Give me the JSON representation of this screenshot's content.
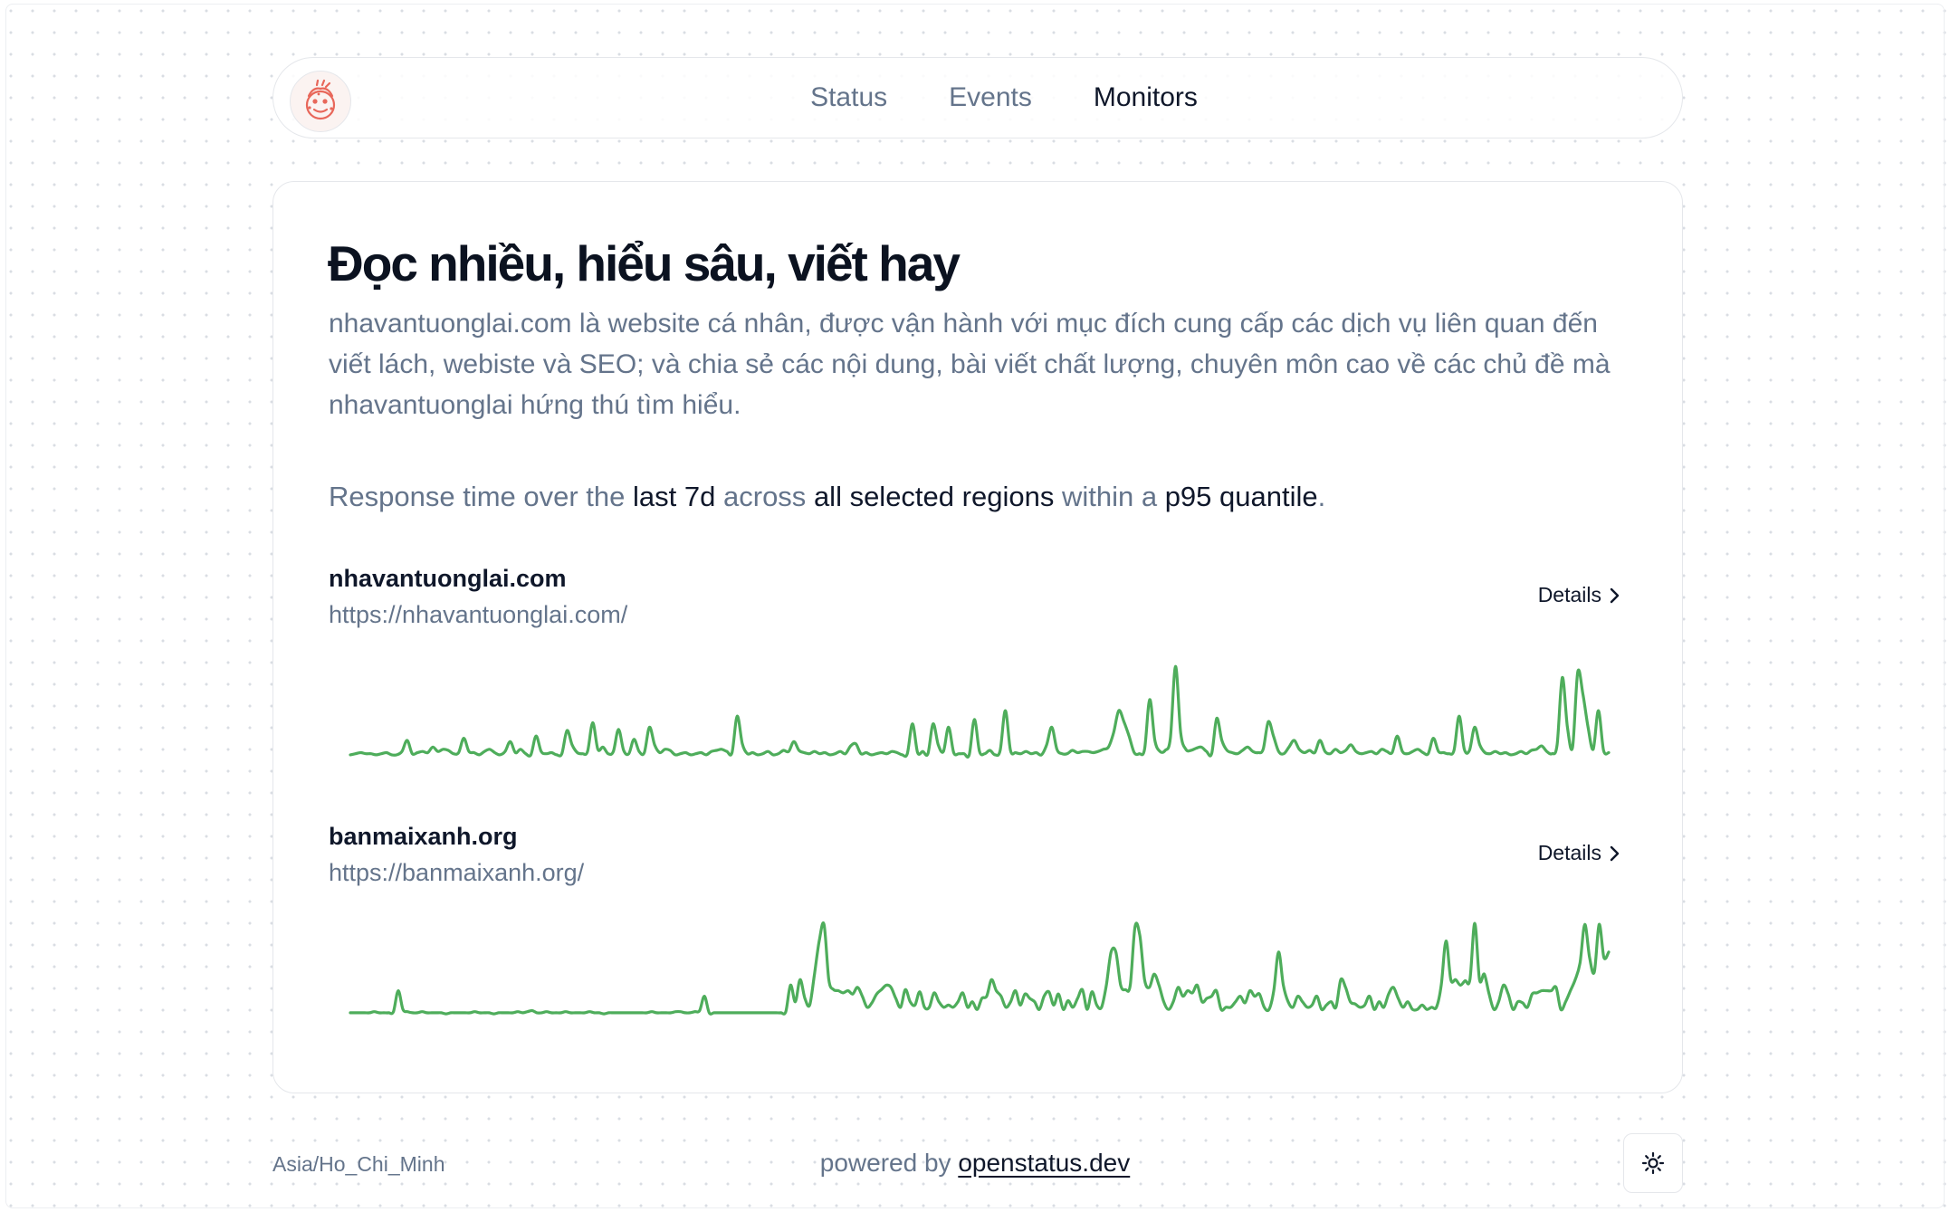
{
  "nav": {
    "items": [
      {
        "label": "Status",
        "active": false
      },
      {
        "label": "Events",
        "active": false
      },
      {
        "label": "Monitors",
        "active": true
      }
    ]
  },
  "page": {
    "title": "Đọc nhiều, hiểu sâu, viết hay",
    "description": "nhavantuonglai.com là website cá nhân, được vận hành với mục đích cung cấp các dịch vụ liên quan đến viết lách, webiste và SEO; và chia sẻ các nội dung, bài viết chất lượng, chuyên môn cao về các chủ đề mà nhavantuonglai hứng thú tìm hiểu."
  },
  "summary": {
    "part1": "Response time over the",
    "period": "last 7d",
    "part2": "across",
    "regions": "all selected regions",
    "part3": "within a",
    "quantile": "p95 quantile",
    "end": "."
  },
  "monitors": [
    {
      "name": "nhavantuonglai.com",
      "url": "https://nhavantuonglai.com/",
      "details_label": "Details"
    },
    {
      "name": "banmaixanh.org",
      "url": "https://banmaixanh.org/",
      "details_label": "Details"
    }
  ],
  "chart_data": [
    {
      "type": "line",
      "series": [
        {
          "values": [
            5,
            6,
            7,
            6,
            6,
            5,
            6,
            7,
            5,
            5,
            8,
            18,
            6,
            7,
            8,
            7,
            12,
            8,
            10,
            9,
            6,
            7,
            20,
            8,
            7,
            5,
            8,
            10,
            7,
            5,
            8,
            17,
            7,
            10,
            6,
            5,
            22,
            8,
            6,
            7,
            5,
            6,
            27,
            14,
            7,
            6,
            8,
            34,
            10,
            12,
            6,
            8,
            28,
            9,
            6,
            19,
            8,
            7,
            30,
            14,
            7,
            10,
            9,
            5,
            6,
            7,
            5,
            6,
            7,
            5,
            8,
            9,
            10,
            8,
            7,
            40,
            15,
            6,
            7,
            5,
            6,
            8,
            5,
            6,
            9,
            8,
            17,
            9,
            7,
            6,
            8,
            6,
            7,
            5,
            6,
            8,
            6,
            13,
            15,
            6,
            7,
            5,
            6,
            7,
            6,
            8,
            7,
            5,
            6,
            33,
            7,
            8,
            6,
            33,
            14,
            8,
            30,
            7,
            6,
            6,
            5,
            37,
            8,
            6,
            9,
            5,
            9,
            45,
            9,
            7,
            6,
            8,
            6,
            7,
            5,
            14,
            30,
            10,
            6,
            6,
            9,
            7,
            8,
            8,
            7,
            8,
            10,
            12,
            25,
            45,
            35,
            22,
            7,
            6,
            10,
            55,
            18,
            8,
            9,
            20,
            85,
            25,
            10,
            9,
            11,
            12,
            8,
            6,
            38,
            18,
            9,
            7,
            6,
            9,
            12,
            8,
            7,
            10,
            35,
            22,
            8,
            6,
            12,
            18,
            10,
            7,
            9,
            7,
            18,
            8,
            6,
            10,
            7,
            9,
            14,
            8,
            6,
            7,
            8,
            6,
            10,
            8,
            7,
            22,
            8,
            6,
            8,
            10,
            7,
            6,
            20,
            8,
            7,
            6,
            9,
            40,
            10,
            9,
            30,
            14,
            7,
            6,
            8,
            6,
            7,
            5,
            6,
            8,
            6,
            9,
            10,
            13,
            8,
            6,
            14,
            75,
            30,
            12,
            80,
            60,
            30,
            10,
            45,
            9,
            7
          ]
        }
      ],
      "ylim": [
        0,
        100
      ]
    },
    {
      "type": "line",
      "series": [
        {
          "values": [
            5,
            5,
            5,
            5,
            5,
            6,
            5,
            5,
            5,
            6,
            25,
            8,
            6,
            5,
            5,
            6,
            5,
            5,
            5,
            5,
            4,
            5,
            5,
            5,
            5,
            5,
            6,
            5,
            5,
            5,
            4,
            5,
            5,
            5,
            5,
            6,
            5,
            6,
            7,
            5,
            5,
            6,
            5,
            5,
            5,
            6,
            5,
            5,
            5,
            5,
            6,
            5,
            5,
            4,
            5,
            5,
            5,
            5,
            5,
            5,
            5,
            5,
            5,
            6,
            5,
            5,
            5,
            5,
            6,
            6,
            5,
            5,
            6,
            7,
            20,
            5,
            5,
            5,
            5,
            5,
            5,
            5,
            5,
            5,
            5,
            5,
            5,
            5,
            5,
            5,
            5,
            6,
            30,
            15,
            35,
            18,
            12,
            40,
            70,
            85,
            35,
            26,
            25,
            23,
            25,
            22,
            28,
            20,
            10,
            14,
            22,
            26,
            30,
            28,
            18,
            10,
            26,
            15,
            12,
            24,
            10,
            10,
            23,
            15,
            10,
            12,
            10,
            15,
            23,
            10,
            15,
            8,
            18,
            20,
            35,
            25,
            20,
            10,
            15,
            25,
            12,
            22,
            18,
            15,
            8,
            20,
            24,
            12,
            22,
            8,
            16,
            10,
            18,
            26,
            8,
            24,
            12,
            10,
            30,
            60,
            60,
            30,
            26,
            30,
            83,
            75,
            35,
            28,
            40,
            30,
            15,
            8,
            15,
            28,
            20,
            25,
            23,
            30,
            15,
            18,
            20,
            25,
            8,
            10,
            10,
            15,
            20,
            14,
            25,
            20,
            22,
            10,
            8,
            25,
            60,
            30,
            15,
            10,
            20,
            15,
            10,
            12,
            20,
            8,
            12,
            15,
            10,
            35,
            28,
            15,
            13,
            10,
            12,
            20,
            8,
            15,
            10,
            22,
            28,
            18,
            10,
            15,
            8,
            8,
            12,
            8,
            10,
            10,
            30,
            70,
            35,
            35,
            30,
            34,
            35,
            86,
            35,
            40,
            22,
            8,
            15,
            30,
            22,
            8,
            15,
            14,
            10,
            22,
            23,
            25,
            25,
            25,
            28,
            8,
            15,
            25,
            35,
            50,
            85,
            55,
            42,
            85,
            55,
            60
          ]
        }
      ],
      "ylim": [
        0,
        100
      ]
    }
  ],
  "footer": {
    "timezone": "Asia/Ho_Chi_Minh",
    "powered_prefix": "powered by",
    "powered_link": "openstatus.dev"
  },
  "colors": {
    "line": "#4ead5b",
    "muted_text": "#64748b",
    "border": "#e5e7eb",
    "logo": "#e8675a"
  },
  "icons": {
    "details": "chevron-right-icon",
    "theme_toggle": "sun-icon",
    "logo": "cartoon-logo"
  }
}
